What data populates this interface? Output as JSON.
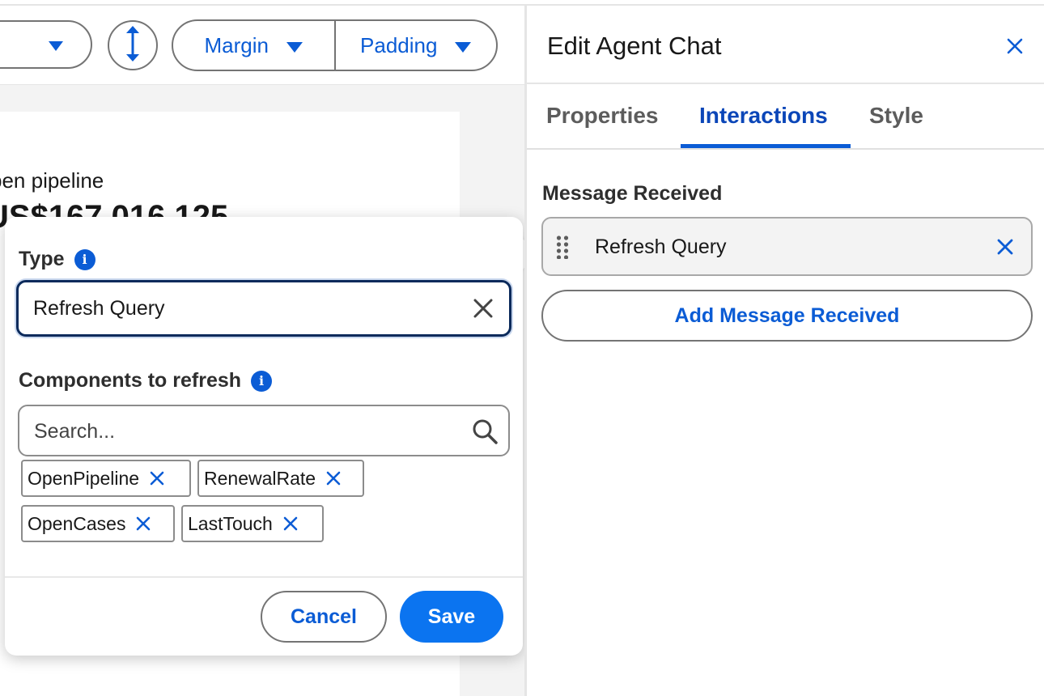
{
  "toolbar": {
    "margin_label": "Margin",
    "padding_label": "Padding"
  },
  "canvas": {
    "card_label": "pen pipeline",
    "card_value": "US$167,016,125"
  },
  "popover": {
    "type_label": "Type",
    "type_value": "Refresh Query",
    "components_label": "Components to refresh",
    "search_placeholder": "Search...",
    "pills": [
      "OpenPipeline",
      "RenewalRate",
      "OpenCases",
      "LastTouch"
    ],
    "cancel_label": "Cancel",
    "save_label": "Save"
  },
  "panel": {
    "title": "Edit Agent Chat",
    "tabs": [
      {
        "label": "Properties",
        "active": false
      },
      {
        "label": "Interactions",
        "active": true
      },
      {
        "label": "Style",
        "active": false
      }
    ],
    "section_label": "Message Received",
    "message_item": "Refresh Query",
    "add_button": "Add Message Received"
  },
  "colors": {
    "accent": "#0b5cd5",
    "primary_button": "#0b74f0",
    "border": "#747474"
  },
  "icons": [
    "caret-down-icon",
    "vertical-resize-icon",
    "info-icon",
    "close-icon",
    "search-icon",
    "drag-handle-icon"
  ]
}
